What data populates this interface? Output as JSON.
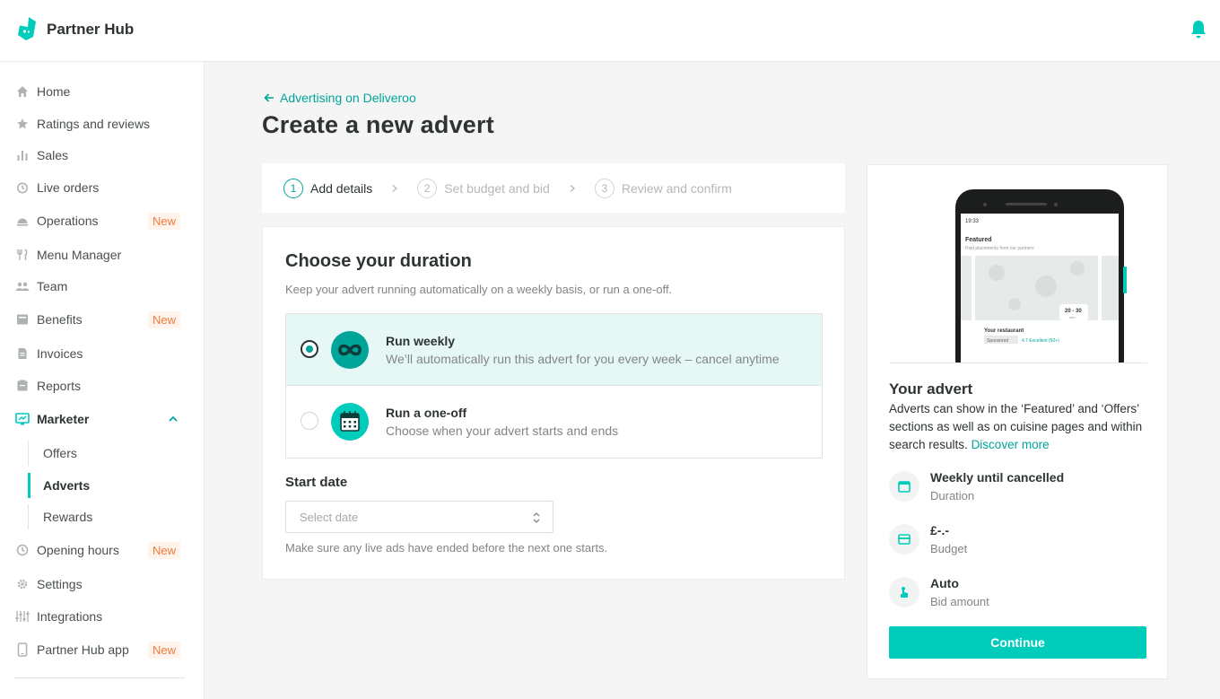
{
  "app": {
    "name": "Partner Hub"
  },
  "colors": {
    "accent": "#00ccbc",
    "accent_dark": "#00a59a",
    "new_badge": "#ef7b3a"
  },
  "sidebar": {
    "items": [
      {
        "label": "Home",
        "icon": "home-icon"
      },
      {
        "label": "Ratings and reviews",
        "icon": "star-icon"
      },
      {
        "label": "Sales",
        "icon": "bar-chart-icon"
      },
      {
        "label": "Live orders",
        "icon": "clock-icon"
      },
      {
        "label": "Operations",
        "icon": "cloche-icon",
        "badge": "New"
      },
      {
        "label": "Menu Manager",
        "icon": "cutlery-icon"
      },
      {
        "label": "Team",
        "icon": "team-icon"
      },
      {
        "label": "Benefits",
        "icon": "benefits-icon",
        "badge": "New"
      },
      {
        "label": "Invoices",
        "icon": "document-icon"
      },
      {
        "label": "Reports",
        "icon": "report-icon"
      },
      {
        "label": "Marketer",
        "icon": "marketer-icon",
        "expanded": true
      },
      {
        "label": "Opening hours",
        "icon": "clock-icon",
        "badge": "New"
      },
      {
        "label": "Settings",
        "icon": "gear-icon"
      },
      {
        "label": "Integrations",
        "icon": "sliders-icon"
      },
      {
        "label": "Partner Hub app",
        "icon": "phone-icon",
        "badge": "New"
      }
    ],
    "marketer_sub": [
      {
        "label": "Offers"
      },
      {
        "label": "Adverts",
        "active": true
      },
      {
        "label": "Rewards"
      }
    ]
  },
  "main": {
    "back_link": "Advertising on Deliveroo",
    "title": "Create a new advert",
    "steps": [
      {
        "num": "1",
        "label": "Add details",
        "active": true
      },
      {
        "num": "2",
        "label": "Set budget and bid"
      },
      {
        "num": "3",
        "label": "Review and confirm"
      }
    ],
    "duration": {
      "title": "Choose your duration",
      "subtitle": "Keep your advert running automatically on a weekly basis, or run a one-off.",
      "options": [
        {
          "title": "Run weekly",
          "desc": "We’ll automatically run this advert for you every week – cancel anytime",
          "selected": true
        },
        {
          "title": "Run a one-off",
          "desc": "Choose when your advert starts and ends",
          "selected": false
        }
      ],
      "start_date_label": "Start date",
      "date_placeholder": "Select date",
      "help": "Make sure any live ads have ended before the next one starts."
    }
  },
  "preview": {
    "phone": {
      "time": "19:33",
      "section": "Featured",
      "section_sub": "Paid placements from our partners",
      "eta": "20 - 30",
      "eta_unit": "min",
      "restaurant": "Your restaurant",
      "tag": "Sponsored",
      "rating": "4.7 Excellent (50+)"
    },
    "title": "Your advert",
    "desc": "Adverts can show in the ‘Featured’ and ‘Offers’ sections as well as on cuisine pages and within search results.",
    "link": "Discover more",
    "summary": [
      {
        "value": "Weekly until cancelled",
        "label": "Duration",
        "icon": "calendar-icon"
      },
      {
        "value": "£-.-",
        "label": "Budget",
        "icon": "card-icon"
      },
      {
        "value": "Auto",
        "label": "Bid amount",
        "icon": "tap-icon"
      }
    ],
    "continue": "Continue"
  }
}
